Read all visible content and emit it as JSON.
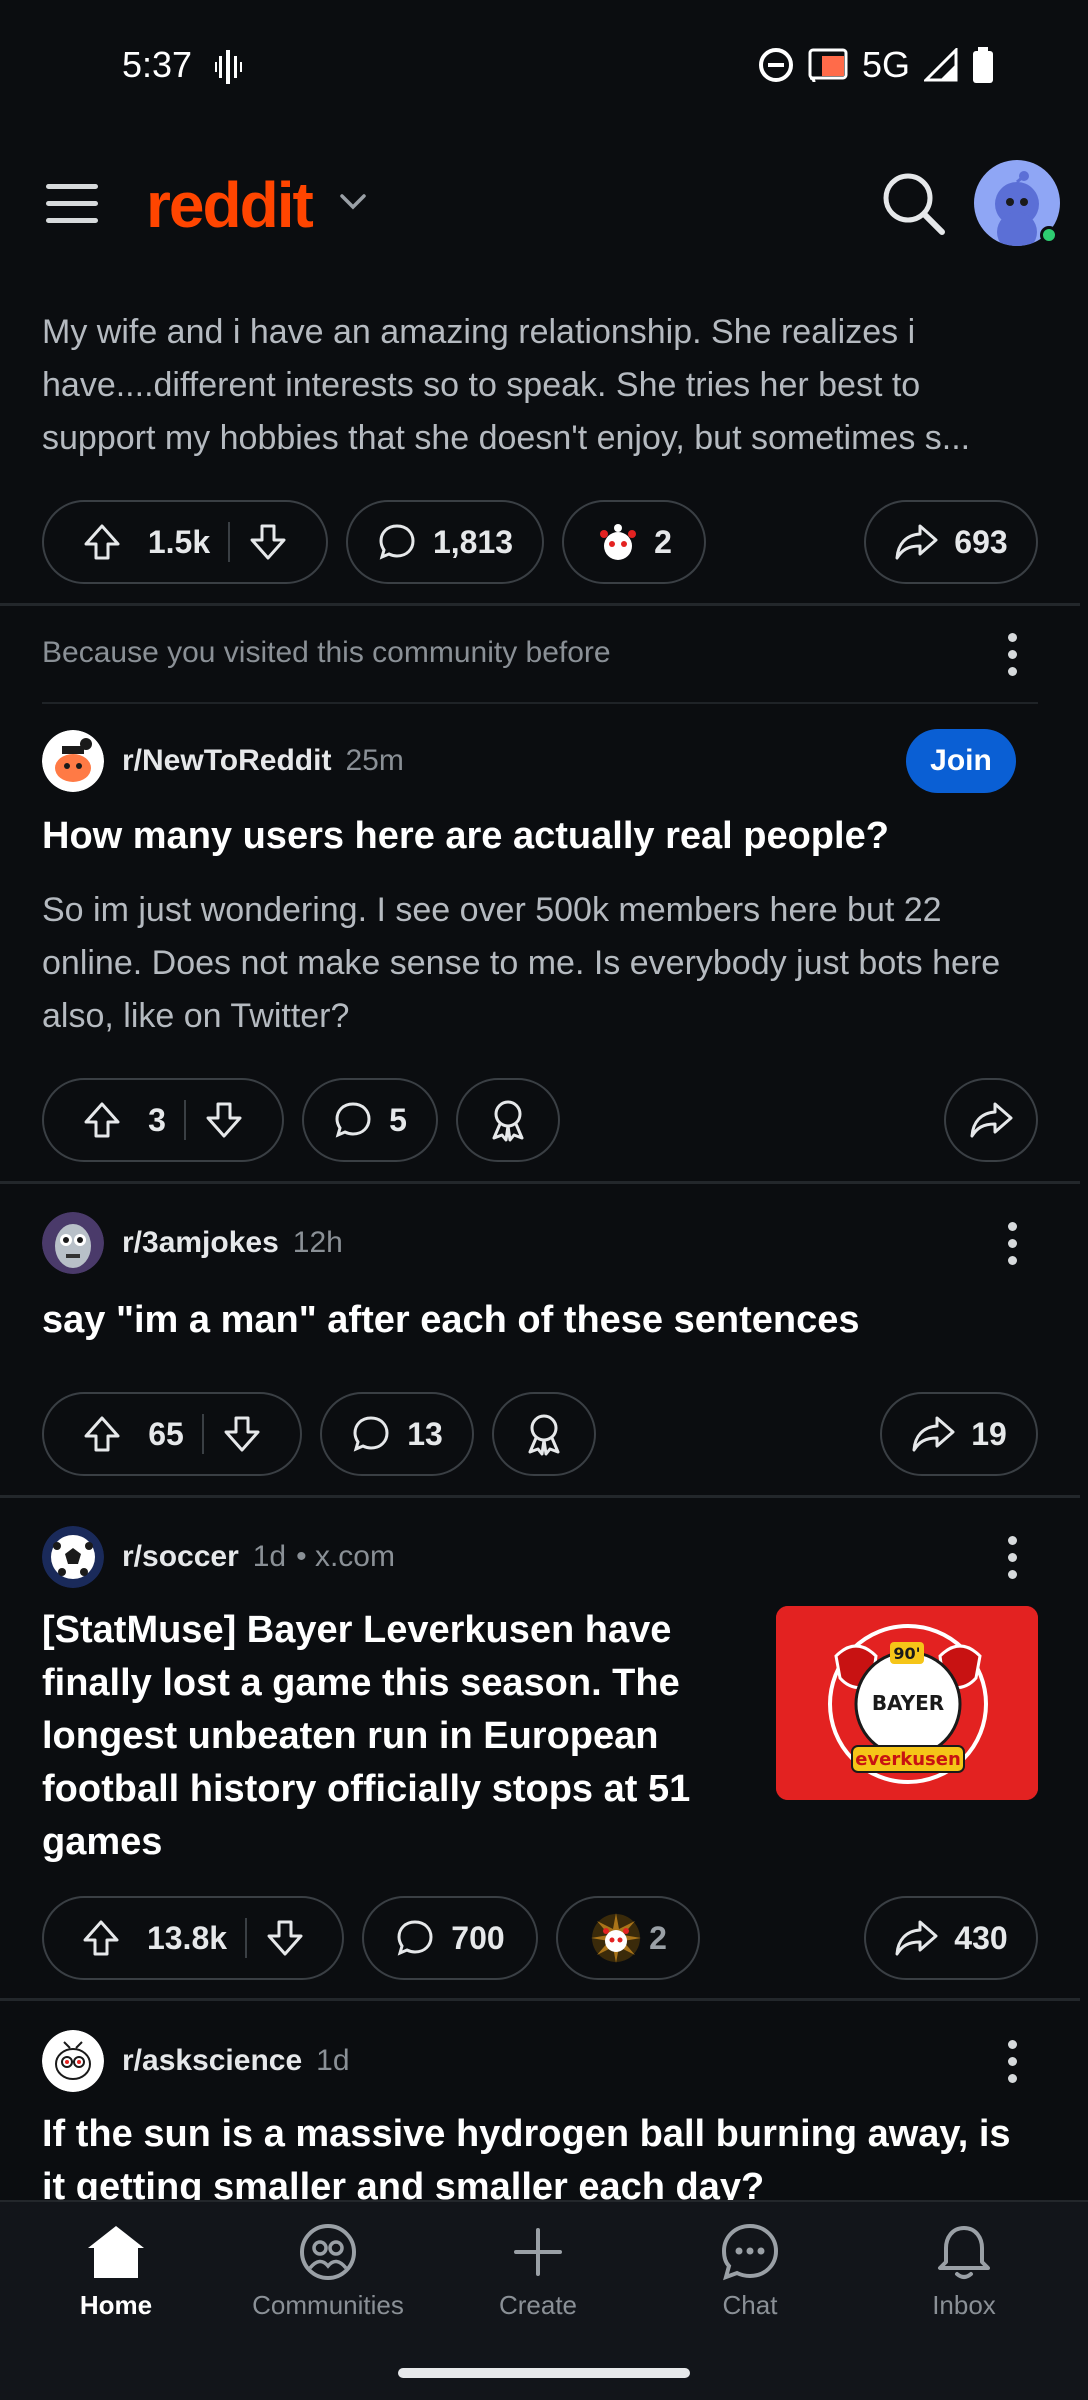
{
  "status_bar": {
    "time": "5:37",
    "network": "5G"
  },
  "header": {
    "logo": "reddit",
    "search_icon": "search-icon",
    "avatar_icon": "avatar"
  },
  "feed": {
    "post0": {
      "body": "My wife and i have an amazing relationship. She realizes i have....different interests so to speak. She tries her best to support my hobbies that she doesn't enjoy, but sometimes s...",
      "upvotes": "1.5k",
      "comments": "1,813",
      "awards": "2",
      "shares": "693"
    },
    "recommendation_reason": "Because you visited this community before",
    "post1": {
      "subreddit": "r/NewToReddit",
      "age": "25m",
      "join_label": "Join",
      "title": "How many users here are actually real people?",
      "body": "So im just wondering. I see over 500k members here but 22 online. Does not make sense to me. Is everybody just bots here also, like on Twitter?",
      "upvotes": "3",
      "comments": "5"
    },
    "post2": {
      "subreddit": "r/3amjokes",
      "age": "12h",
      "title": "say \"im a man\" after each of these sentences",
      "upvotes": "65",
      "comments": "13",
      "shares": "19"
    },
    "post3": {
      "subreddit": "r/soccer",
      "age": "1d",
      "domain": "• x.com",
      "title": "[StatMuse] Bayer Leverkusen have finally lost a game this season. The longest unbeaten run in European football history officially stops at 51 games",
      "upvotes": "13.8k",
      "comments": "700",
      "awards": "2",
      "shares": "430",
      "thumb_text": {
        "year": "90'",
        "name": "BAYER",
        "banner": "everkusen"
      }
    },
    "post4": {
      "subreddit": "r/askscience",
      "age": "1d",
      "title": "If the sun is a massive hydrogen ball burning away, is it getting smaller and smaller each day?"
    }
  },
  "bottom_nav": {
    "items": [
      {
        "label": "Home"
      },
      {
        "label": "Communities"
      },
      {
        "label": "Create"
      },
      {
        "label": "Chat"
      },
      {
        "label": "Inbox"
      }
    ]
  },
  "colors": {
    "brand": "#ff4500",
    "join": "#0a5fd4",
    "background": "#0b0d10"
  }
}
